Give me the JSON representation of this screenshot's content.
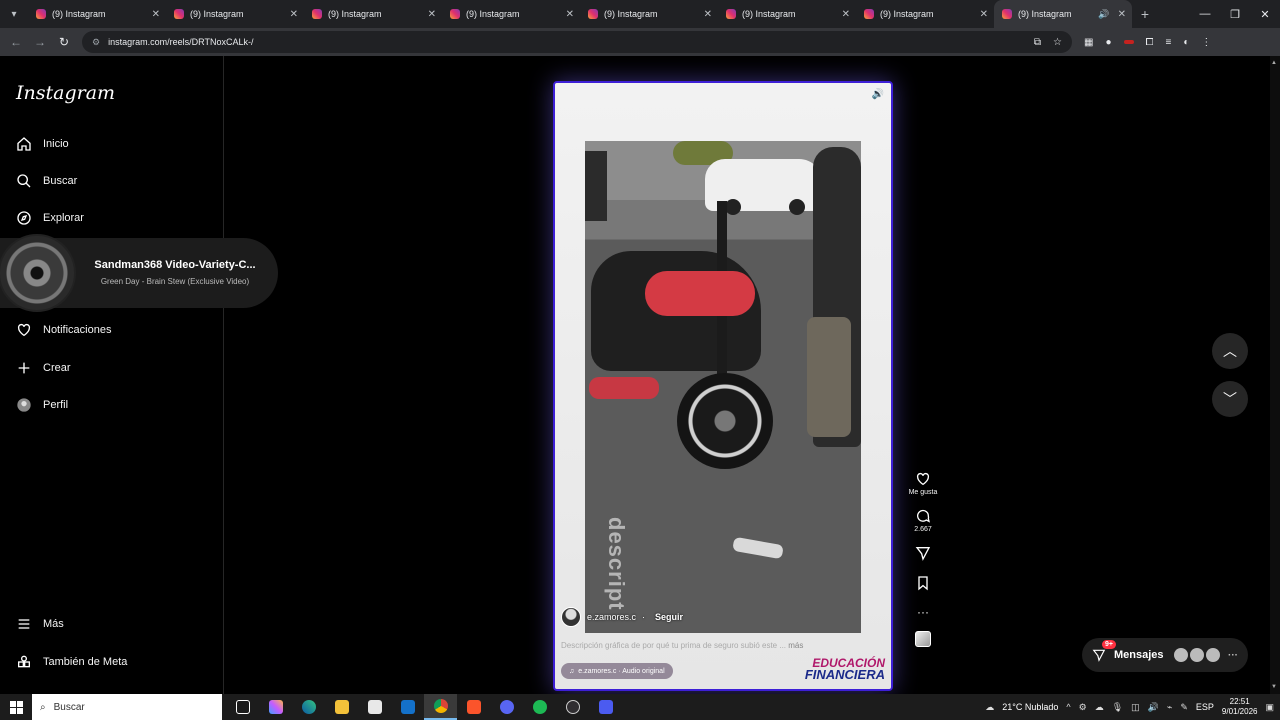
{
  "browser": {
    "tabs": [
      {
        "title": "(9) Instagram"
      },
      {
        "title": "(9) Instagram"
      },
      {
        "title": "(9) Instagram"
      },
      {
        "title": "(9) Instagram"
      },
      {
        "title": "(9) Instagram"
      },
      {
        "title": "(9) Instagram"
      },
      {
        "title": "(9) Instagram"
      },
      {
        "title": "(9) Instagram",
        "active": true
      }
    ],
    "url": "instagram.com/reels/DRTNoxCALk-/"
  },
  "sidebar": {
    "logo": "Instagram",
    "items": [
      {
        "label": "Inicio",
        "icon": "home-icon"
      },
      {
        "label": "Buscar",
        "icon": "search-icon"
      },
      {
        "label": "Explorar",
        "icon": "compass-icon"
      },
      {
        "label": "Notificaciones",
        "icon": "heart-icon"
      },
      {
        "label": "Crear",
        "icon": "plus-icon"
      },
      {
        "label": "Perfil",
        "icon": "avatar"
      }
    ],
    "bottom": [
      {
        "label": "Más",
        "icon": "menu-icon"
      },
      {
        "label": "También de Meta",
        "icon": "meta-icon"
      }
    ]
  },
  "mini_player": {
    "title": "Sandman368 Video-Variety-C...",
    "subtitle": "Green Day - Brain Stew (Exclusive Video)"
  },
  "reel": {
    "watermark": "descript",
    "author": "e.zamores.c",
    "follow": "Seguir",
    "caption": "Descripción gráfica de por qué tu prima de seguro subió este ...",
    "caption_more": "más",
    "audio": "e.zamores.c · Audio original",
    "banner_line1": "EDUCACIÓN",
    "banner_line2": "FINANCIERA"
  },
  "actions": {
    "like_label": "Me gusta",
    "comments_count": "2.667"
  },
  "messages": {
    "label": "Mensajes",
    "badge": "9+"
  },
  "taskbar": {
    "search_placeholder": "Buscar",
    "weather": "21°C  Nublado",
    "language": "ESP",
    "time": "22:51",
    "date": "9/01/2026"
  },
  "colors": {
    "accent_border": "#3d1fd6",
    "badge": "#ff3040"
  }
}
